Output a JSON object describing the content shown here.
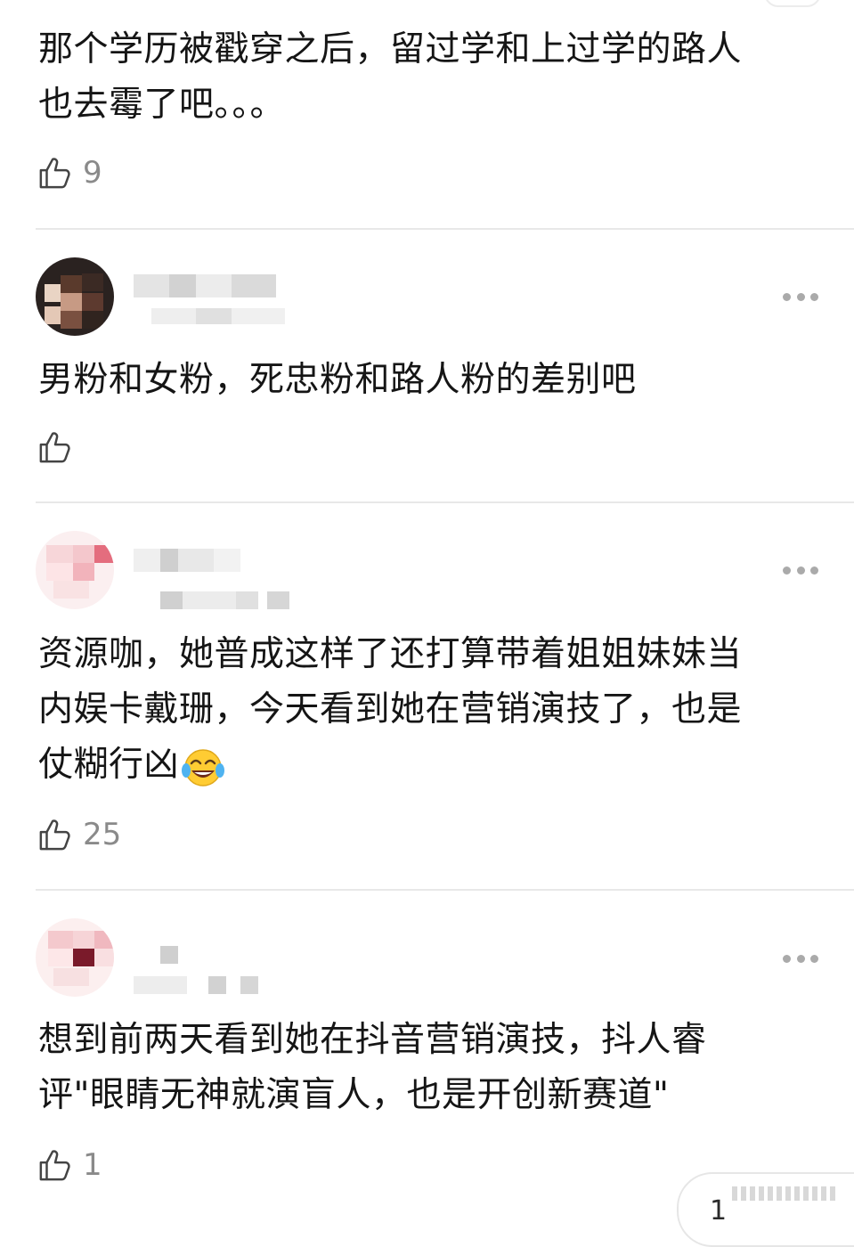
{
  "comments": [
    {
      "text_lines": [
        "那个学历被戳穿之后，留过学和上过学的路人",
        "也去霉了吧。。。"
      ],
      "likes": "9"
    },
    {
      "text_lines": [
        "男粉和女粉，死忠粉和路人粉的差别吧"
      ],
      "likes": ""
    },
    {
      "text_lines": [
        "资源咖，她普成这样了还打算带着姐姐妹妹当",
        "内娱卡戴珊，今天看到她在营销演技了，也是",
        "仗糊行凶"
      ],
      "likes": "25"
    },
    {
      "text_lines": [
        "想到前两天看到她在抖音营销演技，抖人睿",
        "评\"眼睛无神就演盲人，也是开创新赛道\""
      ],
      "likes": "1"
    }
  ],
  "page_indicator": {
    "current": "1"
  },
  "icons": {
    "like": "thumbs-up-icon",
    "more": "more-dots-icon",
    "emoji": "tears-of-joy-emoji"
  },
  "colors": {
    "text": "#151515",
    "muted": "#8a8a8a",
    "divider": "#e8e8e8",
    "dots": "#aaaaaa"
  }
}
